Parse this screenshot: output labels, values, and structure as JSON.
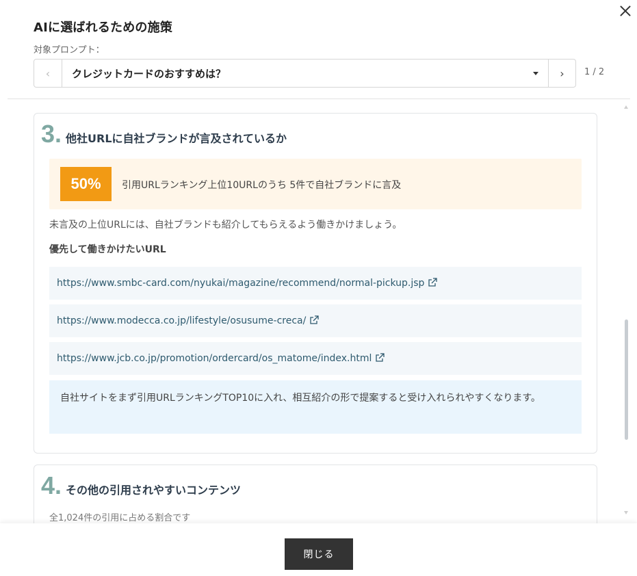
{
  "modal": {
    "title": "AIに選ばれるための施策",
    "prompt_label": "対象プロンプト：",
    "prompt_selected": "クレジットカードのおすすめは？",
    "page_indicator": "1 / 2",
    "prev_icon": "‹",
    "next_icon": "›"
  },
  "sections": {
    "s3": {
      "number": "3.",
      "title": "他社URLに自社ブランドが言及されているか",
      "percentage": "50%",
      "stat_text": "引用URLランキング上位10URLのうち 5件で自社ブランドに言及",
      "advice": "未言及の上位URLには、自社ブランドも紹介してもらえるよう働きかけましょう。",
      "priority_label": "優先して働きかけたいURL",
      "urls": [
        "https://www.smbc-card.com/nyukai/magazine/recommend/normal-pickup.jsp",
        "https://www.modecca.co.jp/lifestyle/osusume-creca/",
        "https://www.jcb.co.jp/promotion/ordercard/os_matome/index.html"
      ],
      "tip": "自社サイトをまず引用URLランキングTOP10に入れ、相互紹介の形で提案すると受け入れられやすくなります。"
    },
    "s4": {
      "number": "4.",
      "title": "その他の引用されやすいコンテンツ",
      "subtitle": "全1,024件の引用に占める割合です"
    }
  },
  "footer": {
    "close_label": "閉じる"
  },
  "colors": {
    "accent_number": "#7fa8a2",
    "badge": "#f29a14",
    "stat_bg": "#fff6e9",
    "tip_bg": "#eaf5fd",
    "link": "#2e5a6e"
  },
  "icons": {
    "close": "close-icon",
    "external": "external-link-icon",
    "caret": "caret-down-icon"
  }
}
